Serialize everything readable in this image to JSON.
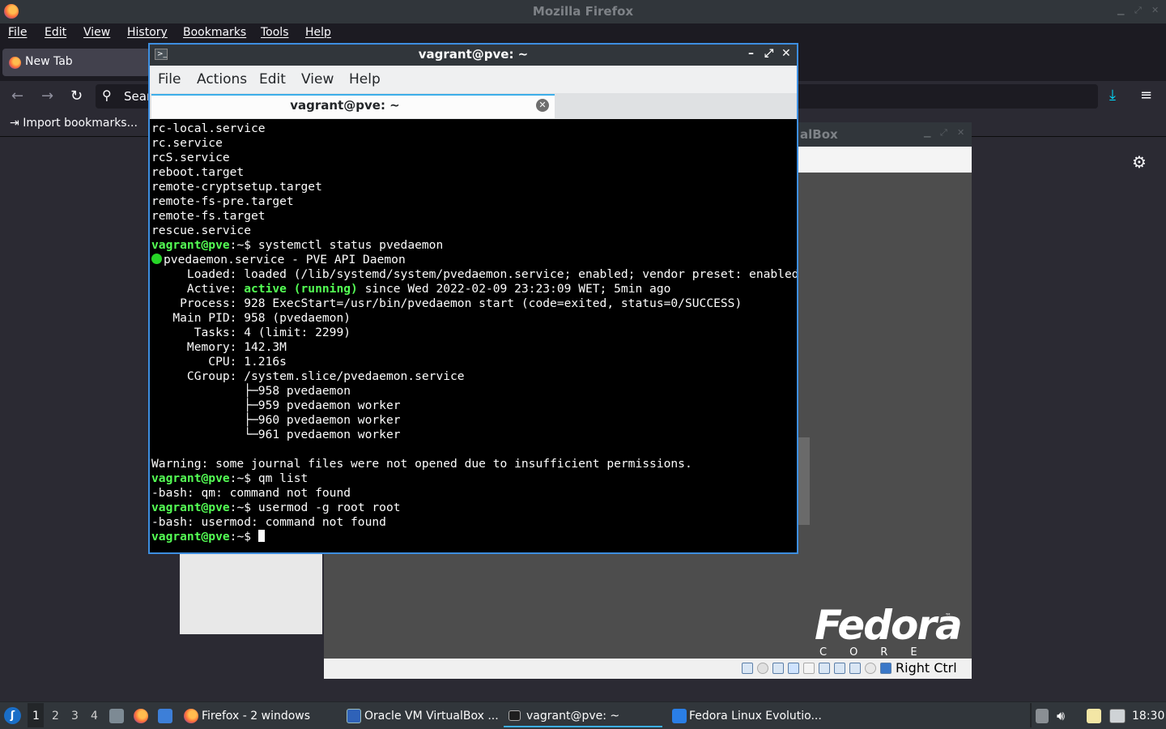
{
  "firefox": {
    "window_title": "Mozilla Firefox",
    "menu": [
      "File",
      "Edit",
      "View",
      "History",
      "Bookmarks",
      "Tools",
      "Help"
    ],
    "tab_label": "New Tab",
    "url_placeholder": "Sear",
    "bookmark_import": "Import bookmarks...",
    "icons": [
      "firefox-logo",
      "back-icon",
      "forward-icon",
      "reload-icon",
      "search-icon",
      "download-icon",
      "hamburger-menu-icon",
      "gear-icon"
    ]
  },
  "virtualbox": {
    "title_fragment": "alBox",
    "host_key": "Right Ctrl",
    "fedora_logo": "Fedora",
    "fedora_tm": "™",
    "fedora_core": "CORE"
  },
  "terminal": {
    "window_title": "vagrant@pve: ~",
    "menu": [
      "File",
      "Actions",
      "Edit",
      "View",
      "Help"
    ],
    "tab_label": "vagrant@pve: ~",
    "prompt_user": "vagrant@pve",
    "prompt_rest": ":~$ ",
    "lines": [
      {
        "type": "out",
        "text": "rc-local.service"
      },
      {
        "type": "out",
        "text": "rc.service"
      },
      {
        "type": "out",
        "text": "rcS.service"
      },
      {
        "type": "out",
        "text": "reboot.target"
      },
      {
        "type": "out",
        "text": "remote-cryptsetup.target"
      },
      {
        "type": "out",
        "text": "remote-fs-pre.target"
      },
      {
        "type": "out",
        "text": "remote-fs.target"
      },
      {
        "type": "out",
        "text": "rescue.service"
      },
      {
        "type": "cmd",
        "text": "systemctl status pvedaemon"
      },
      {
        "type": "dot",
        "text": "pvedaemon.service - PVE API Daemon"
      },
      {
        "type": "out",
        "text": "     Loaded: loaded (/lib/systemd/system/pvedaemon.service; enabled; vendor preset: enabled)"
      },
      {
        "type": "active",
        "pre": "     Active: ",
        "hl": "active (running)",
        "post": " since Wed 2022-02-09 23:23:09 WET; 5min ago"
      },
      {
        "type": "out",
        "text": "    Process: 928 ExecStart=/usr/bin/pvedaemon start (code=exited, status=0/SUCCESS)"
      },
      {
        "type": "out",
        "text": "   Main PID: 958 (pvedaemon)"
      },
      {
        "type": "out",
        "text": "      Tasks: 4 (limit: 2299)"
      },
      {
        "type": "out",
        "text": "     Memory: 142.3M"
      },
      {
        "type": "out",
        "text": "        CPU: 1.216s"
      },
      {
        "type": "out",
        "text": "     CGroup: /system.slice/pvedaemon.service"
      },
      {
        "type": "out",
        "text": "             ├─958 pvedaemon"
      },
      {
        "type": "out",
        "text": "             ├─959 pvedaemon worker"
      },
      {
        "type": "out",
        "text": "             ├─960 pvedaemon worker"
      },
      {
        "type": "out",
        "text": "             └─961 pvedaemon worker"
      },
      {
        "type": "out",
        "text": ""
      },
      {
        "type": "out",
        "text": "Warning: some journal files were not opened due to insufficient permissions."
      },
      {
        "type": "cmd",
        "text": "qm list"
      },
      {
        "type": "out",
        "text": "-bash: qm: command not found"
      },
      {
        "type": "cmd",
        "text": "usermod -g root root"
      },
      {
        "type": "out",
        "text": "-bash: usermod: command not found"
      },
      {
        "type": "prompt",
        "text": ""
      }
    ]
  },
  "taskbar": {
    "workspaces": [
      "1",
      "2",
      "3",
      "4"
    ],
    "active_workspace": "1",
    "items": [
      "Firefox - 2 windows",
      "Oracle VM VirtualBox ...",
      "vagrant@pve: ~",
      "Fedora Linux Evolutio..."
    ],
    "clock": "18:30"
  }
}
